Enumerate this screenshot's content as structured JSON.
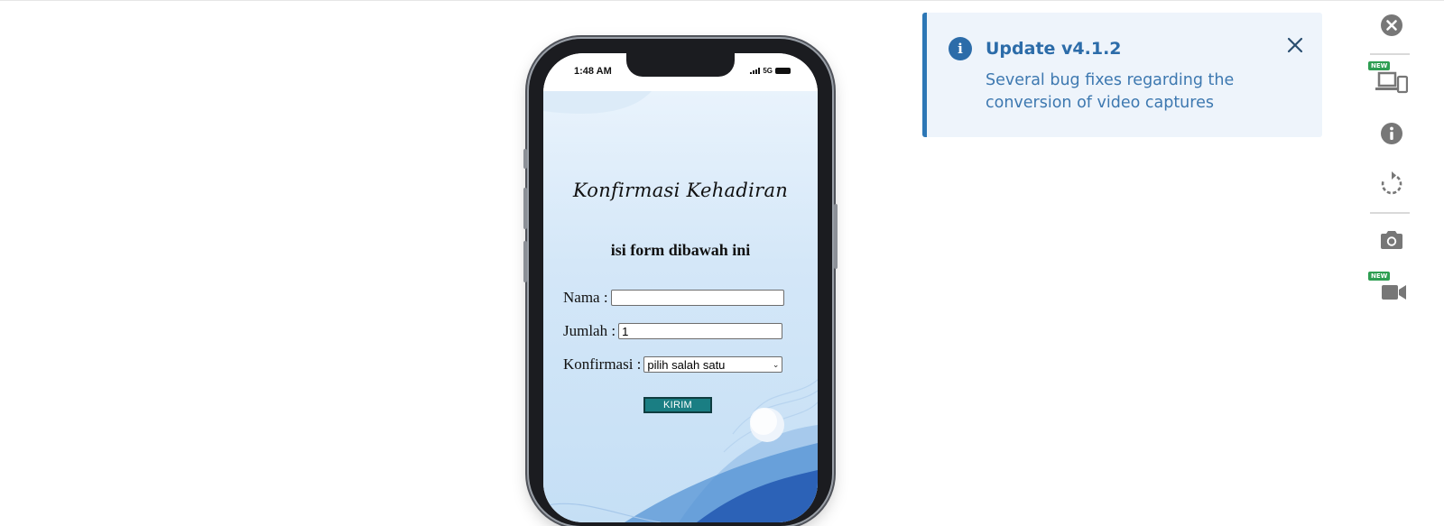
{
  "phone": {
    "time": "1:48 AM",
    "network": "5G",
    "title": "Konfirmasi Kehadiran",
    "subtitle": "isi form dibawah ini",
    "form": {
      "nama_label": "Nama :",
      "nama_value": "",
      "jumlah_label": "Jumlah :",
      "jumlah_value": "1",
      "konfirmasi_label": "Konfirmasi :",
      "konfirmasi_selected": "pilih salah satu",
      "submit_label": "KIRIM"
    }
  },
  "notification": {
    "title": "Update v4.1.2",
    "body": "Several bug fixes regarding the conversion of video captures",
    "accent_color": "#2c77b6"
  },
  "sidebar": {
    "items": [
      {
        "icon": "close-circle-icon"
      },
      {
        "icon": "device-mockup-icon",
        "badge": "NEW"
      },
      {
        "icon": "info-icon"
      },
      {
        "icon": "rotate-icon"
      },
      {
        "icon": "camera-icon"
      },
      {
        "icon": "video-camera-icon",
        "badge": "NEW"
      }
    ]
  }
}
